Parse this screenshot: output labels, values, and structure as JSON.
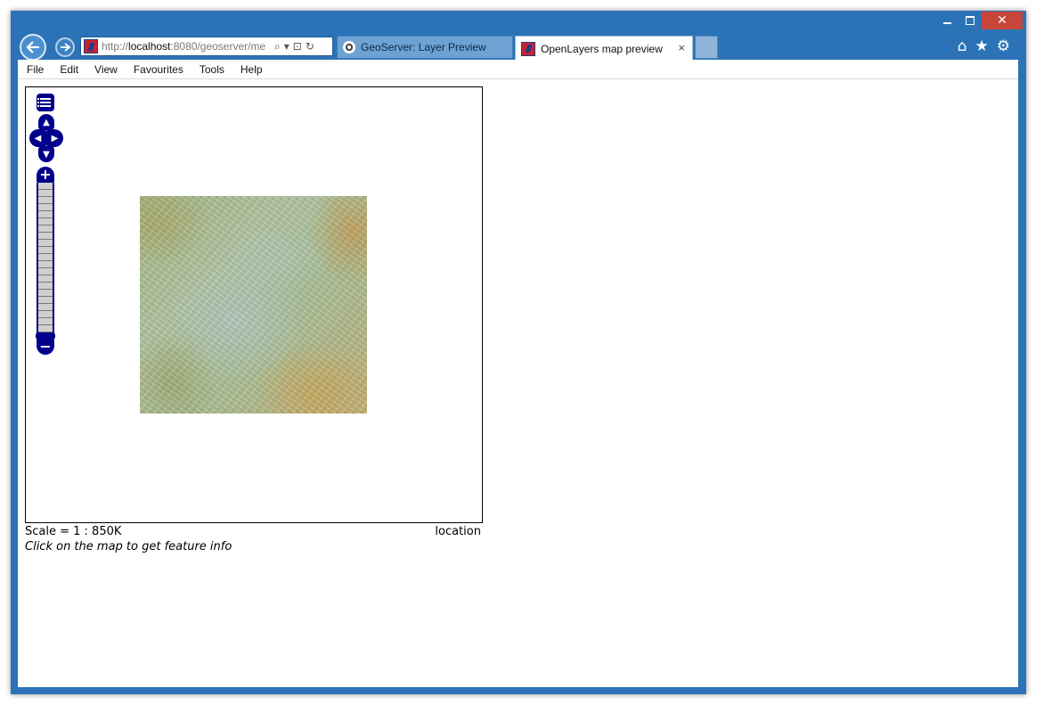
{
  "window_controls": {
    "minimize": "minimize",
    "maximize": "maximize",
    "close": "✕"
  },
  "nav": {
    "address": {
      "prefix": "http://",
      "host": "localhost",
      "rest": ":8080/geoserver/me"
    },
    "tabs": [
      {
        "label": "GeoServer: Layer Preview",
        "active": false
      },
      {
        "label": "OpenLayers map preview",
        "active": true
      }
    ],
    "tab_close": "×",
    "icons": {
      "home": "⌂",
      "favorites": "★",
      "tools": "⚙",
      "search": "⌕",
      "compat": "⊡",
      "refresh": "↻"
    }
  },
  "menu": [
    "File",
    "Edit",
    "View",
    "Favourites",
    "Tools",
    "Help"
  ],
  "map": {
    "controls": {
      "zoom_in": "+",
      "zoom_out": "−",
      "pan_up": "▲",
      "pan_down": "▼",
      "pan_left": "◀",
      "pan_right": "▶"
    },
    "zoom_level_fraction": 0.0,
    "scale_label": "Scale = 1 : 850K",
    "location_label": "location",
    "hint": "Click on the map to get feature info"
  },
  "colors": {
    "window_frame": "#2b73b6",
    "map_controls": "#00008b",
    "close_button": "#c7463a"
  }
}
